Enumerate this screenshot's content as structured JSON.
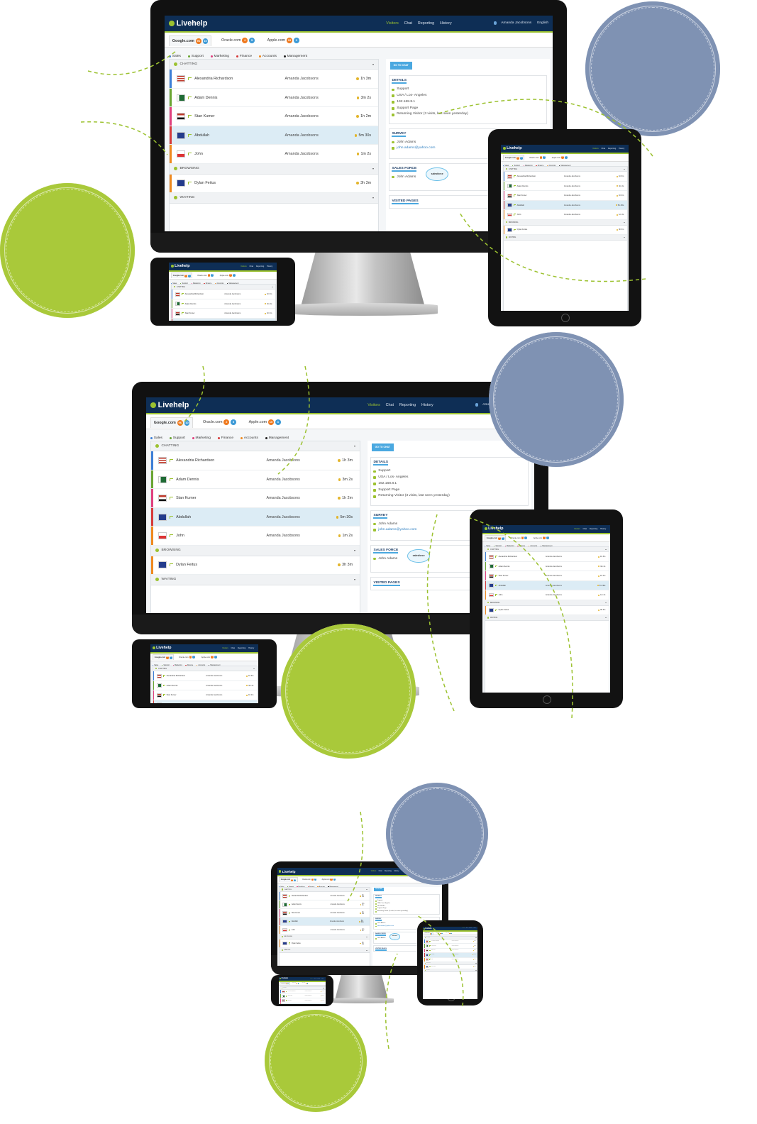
{
  "app": {
    "logo": "Livehelp",
    "nav": [
      "Visitors",
      "Chat",
      "Reporting",
      "History"
    ],
    "user": "Amanda Jacobsons",
    "language": "English",
    "tabs": [
      {
        "label": "Google.com",
        "b1": "96",
        "b2": "10"
      },
      {
        "label": "Oracle.com",
        "b1": "2",
        "b2": "5"
      },
      {
        "label": "Apple.com",
        "b1": "15",
        "b2": "3"
      }
    ],
    "departments": [
      {
        "label": "Sales",
        "color": "#3d7fd6"
      },
      {
        "label": "Support",
        "color": "#6aa533"
      },
      {
        "label": "Marketing",
        "color": "#e0417f"
      },
      {
        "label": "Finance",
        "color": "#d63a3a"
      },
      {
        "label": "Accounts",
        "color": "#ef8a20"
      },
      {
        "label": "Management",
        "color": "#222222"
      }
    ],
    "sections": {
      "chatting": "CHATTING",
      "browsing": "BROWSING",
      "waiting": "WAITING"
    },
    "chatting": [
      {
        "name": "Alexandria Richardson",
        "operator": "Amanda Jacobsons",
        "time": "1h 3m",
        "flag": "us",
        "color": "#3d7fd6"
      },
      {
        "name": "Adam Dennis",
        "operator": "Amanda Jacobsons",
        "time": "3m 2s",
        "flag": "pk",
        "color": "#6aa533"
      },
      {
        "name": "Stan Kumer",
        "operator": "Amanda Jacobsons",
        "time": "1h 2m",
        "flag": "eg",
        "color": "#e0417f"
      },
      {
        "name": "Abdullah",
        "operator": "Amanda Jacobsons",
        "time": "5m 30s",
        "flag": "gb",
        "color": "#d63a3a"
      },
      {
        "name": "John",
        "operator": "Amanda Jacobsons",
        "time": "1m 2s",
        "flag": "pl",
        "color": "#ef8a20"
      }
    ],
    "browsing": [
      {
        "name": "Dylan Feitus",
        "time": "3h 3m",
        "flag": "gb",
        "color": "#ef8a20"
      }
    ],
    "button": "GO TO CHAT",
    "details": {
      "title": "DETAILS",
      "lines": [
        "Support",
        "USA / Los- Angeles",
        "192.168.8.1",
        "Support Page",
        "Returning Visitor (3 visits, last seen yesterday)"
      ]
    },
    "survey": {
      "title": "SURVEY",
      "name": "John Adams",
      "email": "john.adams@yahoo.com"
    },
    "salesforce": {
      "title": "SALES FORCE",
      "name": "John Adams",
      "logo": "salesforce"
    },
    "visited": {
      "title": "VISITED PAGES"
    }
  },
  "colors": {
    "green_circle": "#a9c93a",
    "blue_circle": "#7f92b3",
    "topbar": "#0e2e55",
    "accent": "#9cc230"
  }
}
